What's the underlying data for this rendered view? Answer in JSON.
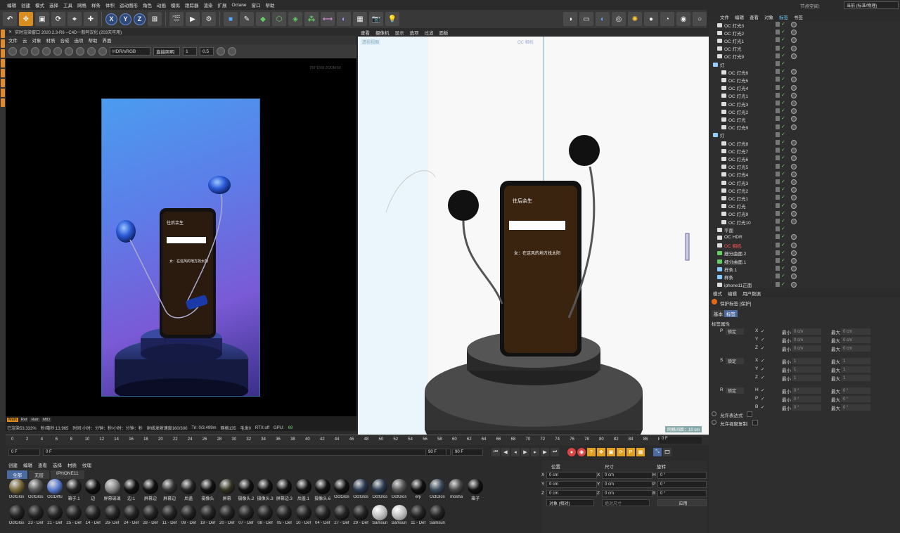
{
  "menubar": [
    "编辑",
    "创建",
    "模式",
    "选择",
    "工具",
    "网格",
    "样条",
    "体积",
    "运动图形",
    "角色",
    "动画",
    "模拟",
    "跟踪器",
    "渲染",
    "扩展",
    "Octane",
    "窗口",
    "帮助"
  ],
  "top_right": {
    "label": "节点空间:",
    "value": "当前 (标准/物理)"
  },
  "toolbar": {
    "x": "X",
    "y": "Y",
    "z": "Z"
  },
  "render_window": {
    "title": "实时渲染窗口 2020.2.3-R6 --C4D一般阿汉化 (203天可用)",
    "menu": [
      "文件",
      "云",
      "对象",
      "材质",
      "合成",
      "选项",
      "帮助",
      "界面"
    ],
    "hdr": "HDR/sRGB",
    "lighting": "直接照明",
    "val1": "1",
    "val2": "0.5",
    "zoom_info": "750*1500 ZOOM:50",
    "tabs": [
      "Main",
      "Ref",
      "Rafr",
      "MID"
    ],
    "status": [
      "已渲染53.333%",
      "秒/毫秒:13.965",
      "时间:小时：分钟：秒/小时：分钟：秒",
      "射线发射速度160/300",
      "Tri: 0/3.499m",
      "网格135",
      "毛发0",
      "RTX:off",
      "GPU:",
      "69"
    ]
  },
  "viewport": {
    "menu": [
      "查看",
      "摄像机",
      "显示",
      "选项",
      "过滤",
      "面板"
    ],
    "cam_label": "透视视图",
    "oc_cam": "OC 相机",
    "grid": "网格间距：10 cm"
  },
  "timeline": {
    "ticks": [
      "0",
      "2",
      "4",
      "6",
      "8",
      "10",
      "12",
      "14",
      "16",
      "18",
      "20",
      "22",
      "24",
      "26",
      "28",
      "30",
      "32",
      "34",
      "36",
      "38",
      "40",
      "42",
      "44",
      "46",
      "48",
      "50",
      "52",
      "54",
      "56",
      "58",
      "60",
      "62",
      "64",
      "66",
      "68",
      "70",
      "72",
      "74",
      "76",
      "78",
      "80",
      "82",
      "84",
      "86",
      "88",
      "90"
    ],
    "end_frame": "0 F",
    "start": "0 F",
    "cur": "0 F",
    "max1": "90 F",
    "max2": "90 F"
  },
  "materials": {
    "menu": [
      "创建",
      "编辑",
      "查看",
      "选择",
      "材质",
      "纹理"
    ],
    "filters": [
      "全部",
      "无层",
      "IPHONE11"
    ],
    "row1": [
      "OctGlos",
      "OctGlos",
      "OctDiffu",
      "箱子.1",
      "边",
      "屏幕玻璃",
      "边.1",
      "屏幕边",
      "屏幕边",
      "后盖",
      "摄像头",
      "屏幕",
      "摄像头.2",
      "摄像头.3",
      "屏幕边.3",
      "后盖.1",
      "摄像头.6",
      "OctGlos",
      "OctGlos",
      "OctGlos",
      "OctGlos",
      "erji",
      "OctGlos",
      "mosha",
      "箱子"
    ],
    "row2": [
      "OctGlos",
      "23 - Def",
      "21 - Def",
      "25 - Def",
      "14 - Def",
      "26- Def",
      "24 - Def",
      "28 - Def",
      "11 - Def",
      "09 - Def",
      "19 - Def",
      "20 - Def",
      "07 - Def",
      "08 - Def",
      "05 - Def",
      "10 - Def",
      "04 - Def",
      "27 - Def",
      "29 - Def",
      "Samsun",
      "Samsun",
      "11 - Def",
      "Samsun"
    ]
  },
  "coords": {
    "headers": [
      "位置",
      "尺寸",
      "旋转"
    ],
    "rows": [
      {
        "a": "X",
        "v1": "0 cm",
        "b": "X",
        "v2": "0 cm",
        "c": "H",
        "v3": "0 °"
      },
      {
        "a": "Y",
        "v1": "0 cm",
        "b": "Y",
        "v2": "0 cm",
        "c": "P",
        "v3": "0 °"
      },
      {
        "a": "Z",
        "v1": "0 cm",
        "b": "Z",
        "v2": "0 cm",
        "c": "B",
        "v3": "0 °"
      }
    ],
    "mode": "对象 (相对)",
    "size_mode": "绝对尺寸",
    "apply": "应用"
  },
  "objects": {
    "menu": [
      "文件",
      "编辑",
      "查看",
      "对象",
      "标签",
      "书签"
    ],
    "items": [
      {
        "name": "OC 灯光3",
        "level": 1
      },
      {
        "name": "OC 灯光2",
        "level": 1
      },
      {
        "name": "OC 灯光1",
        "level": 1
      },
      {
        "name": "OC 灯光",
        "level": 1
      },
      {
        "name": "OC 灯光9",
        "level": 1
      },
      {
        "name": "灯",
        "level": 0
      },
      {
        "name": "OC 灯光6",
        "level": 2
      },
      {
        "name": "OC 灯光5",
        "level": 2
      },
      {
        "name": "OC 灯光4",
        "level": 2
      },
      {
        "name": "OC 灯光1",
        "level": 2
      },
      {
        "name": "OC 灯光3",
        "level": 2
      },
      {
        "name": "OC 灯光2",
        "level": 2
      },
      {
        "name": "OC 灯光",
        "level": 2
      },
      {
        "name": "OC 灯光9",
        "level": 2
      },
      {
        "name": "灯",
        "level": 0
      },
      {
        "name": "OC 灯光8",
        "level": 2
      },
      {
        "name": "OC 灯光7",
        "level": 2
      },
      {
        "name": "OC 灯光6",
        "level": 2
      },
      {
        "name": "OC 灯光5",
        "level": 2
      },
      {
        "name": "OC 灯光4",
        "level": 2
      },
      {
        "name": "OC 灯光3",
        "level": 2
      },
      {
        "name": "OC 灯光2",
        "level": 2
      },
      {
        "name": "OC 灯光1",
        "level": 2
      },
      {
        "name": "OC 灯光",
        "level": 2
      },
      {
        "name": "OC 灯光9",
        "level": 2
      },
      {
        "name": "OC 灯光10",
        "level": 2
      },
      {
        "name": "平面",
        "level": 1
      },
      {
        "name": "OC HDR",
        "level": 1
      },
      {
        "name": "OC 相机",
        "level": 1,
        "red": true
      },
      {
        "name": "细分曲面.2",
        "level": 1
      },
      {
        "name": "细分曲面.1",
        "level": 1
      },
      {
        "name": "样条.1",
        "level": 1
      },
      {
        "name": "样条",
        "level": 1
      },
      {
        "name": "iphone11正面",
        "level": 1
      }
    ]
  },
  "attributes": {
    "menu": [
      "模式",
      "编辑",
      "用户数据"
    ],
    "title": "保护标签 [保护]",
    "tabs": [
      "基本",
      "标签"
    ],
    "section": "标签属性",
    "groups": [
      {
        "k": "P",
        "lock": "锁定",
        "axes": [
          "X",
          "Y",
          "Z"
        ],
        "min": "0 cm",
        "max": "0 cm"
      },
      {
        "k": "S",
        "lock": "锁定",
        "axes": [
          "X",
          "Y",
          "Z"
        ],
        "min": "1",
        "max": "1"
      },
      {
        "k": "R",
        "lock": "锁定",
        "axes": [
          "H",
          "P",
          "B"
        ],
        "min": "0 °",
        "max": "0 °"
      }
    ],
    "min_label": "最小",
    "max_label": "最大",
    "opt1": "允许表达式",
    "opt2": "允许视窗复制"
  }
}
